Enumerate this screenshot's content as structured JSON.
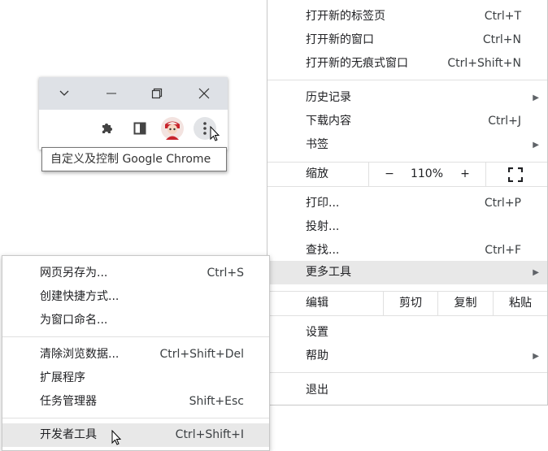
{
  "tooltip": "自定义及控制 Google Chrome",
  "main_menu": {
    "new_tab": {
      "label": "打开新的标签页",
      "shortcut": "Ctrl+T"
    },
    "new_window": {
      "label": "打开新的窗口",
      "shortcut": "Ctrl+N"
    },
    "new_incognito": {
      "label": "打开新的无痕式窗口",
      "shortcut": "Ctrl+Shift+N"
    },
    "history": {
      "label": "历史记录"
    },
    "downloads": {
      "label": "下载内容",
      "shortcut": "Ctrl+J"
    },
    "bookmarks": {
      "label": "书签"
    },
    "zoom": {
      "label": "缩放",
      "minus": "−",
      "value": "110%",
      "plus": "+"
    },
    "print": {
      "label": "打印...",
      "shortcut": "Ctrl+P"
    },
    "cast": {
      "label": "投射..."
    },
    "find": {
      "label": "查找...",
      "shortcut": "Ctrl+F"
    },
    "more_tools": {
      "label": "更多工具"
    },
    "edit": {
      "label": "编辑",
      "cut": "剪切",
      "copy": "复制",
      "paste": "粘贴"
    },
    "settings": {
      "label": "设置"
    },
    "help": {
      "label": "帮助"
    },
    "exit": {
      "label": "退出"
    }
  },
  "sub_menu": {
    "save_page": {
      "label": "网页另存为...",
      "shortcut": "Ctrl+S"
    },
    "create_shortcut": {
      "label": "创建快捷方式..."
    },
    "name_window": {
      "label": "为窗口命名..."
    },
    "clear_data": {
      "label": "清除浏览数据...",
      "shortcut": "Ctrl+Shift+Del"
    },
    "extensions": {
      "label": "扩展程序"
    },
    "task_manager": {
      "label": "任务管理器",
      "shortcut": "Shift+Esc"
    },
    "dev_tools": {
      "label": "开发者工具",
      "shortcut": "Ctrl+Shift+I"
    }
  }
}
